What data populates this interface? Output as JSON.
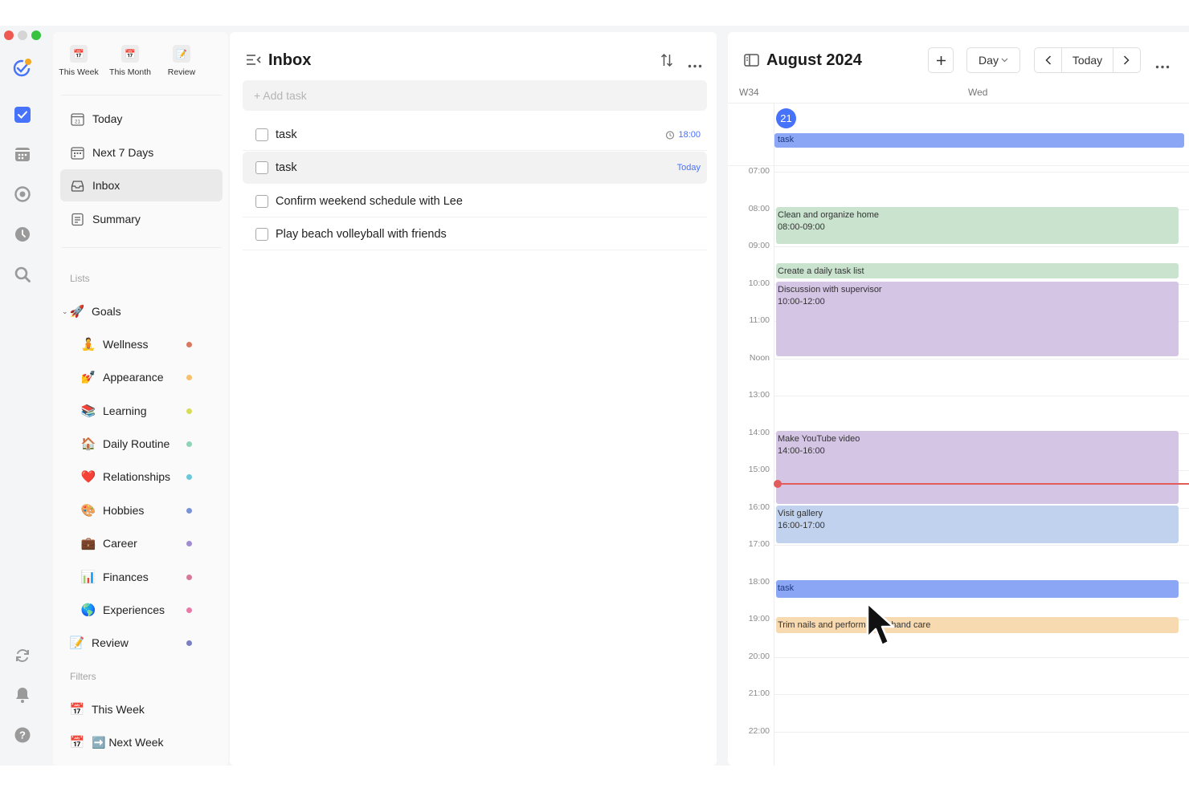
{
  "colors": {
    "accent": "#4772fa",
    "now_line": "#e25c5c",
    "event_green": "#c9e3cf",
    "event_purple": "#d4c5e5",
    "event_blue": "#c0d2ee",
    "event_task": "#8aa6f5",
    "event_orange": "#f8dab1"
  },
  "rail": {
    "icons": [
      "app-logo-icon",
      "tasks-icon",
      "calendar-icon",
      "habit-icon",
      "focus-icon",
      "search-icon",
      "sync-icon",
      "notification-icon",
      "help-icon"
    ]
  },
  "sidebar": {
    "quick": [
      {
        "label": "This Week",
        "icon": "calendar-icon"
      },
      {
        "label": "This Month",
        "icon": "calendar-icon"
      },
      {
        "label": "Review",
        "icon": "memo-icon"
      }
    ],
    "nav": [
      {
        "label": "Today",
        "icon": "today-icon"
      },
      {
        "label": "Next 7 Days",
        "icon": "next-7-days-icon"
      },
      {
        "label": "Inbox",
        "icon": "inbox-icon"
      },
      {
        "label": "Summary",
        "icon": "summary-icon"
      }
    ],
    "lists_label": "Lists",
    "goals": {
      "label": "Goals",
      "emoji": "🚀"
    },
    "goal_items": [
      {
        "label": "Wellness",
        "emoji": "🧘",
        "color": "#d9775f"
      },
      {
        "label": "Appearance",
        "emoji": "💅",
        "color": "#f5c16c"
      },
      {
        "label": "Learning",
        "emoji": "📚",
        "color": "#d7dc5a"
      },
      {
        "label": "Daily Routine",
        "emoji": "🏠",
        "color": "#8fd3b8"
      },
      {
        "label": "Relationships",
        "emoji": "❤️",
        "color": "#6ac8d9"
      },
      {
        "label": "Hobbies",
        "emoji": "🎨",
        "color": "#7a93d6"
      },
      {
        "label": "Career",
        "emoji": "💼",
        "color": "#a08cd3"
      },
      {
        "label": "Finances",
        "emoji": "📊",
        "color": "#d77896"
      },
      {
        "label": "Experiences",
        "emoji": "🌎",
        "color": "#e879a8"
      }
    ],
    "review": {
      "label": "Review",
      "emoji": "📝",
      "color": "#7a7fc0"
    },
    "filters_label": "Filters",
    "filters": [
      {
        "label": "This Week",
        "emoji": "📅"
      },
      {
        "label": "➡️ Next Week",
        "emoji": "📅"
      }
    ]
  },
  "inbox": {
    "title": "Inbox",
    "add_placeholder": "+ Add task",
    "tasks": [
      {
        "title": "task",
        "meta": "18:00",
        "has_alarm": true
      },
      {
        "title": "task",
        "meta": "Today",
        "has_alarm": false
      },
      {
        "title": "Confirm weekend schedule with Lee",
        "meta": "",
        "has_alarm": false
      },
      {
        "title": "Play beach volleyball with friends",
        "meta": "",
        "has_alarm": false
      }
    ]
  },
  "calendar": {
    "title": "August 2024",
    "view": "Day",
    "today_label": "Today",
    "week": "W34",
    "weekday": "Wed",
    "date": "21",
    "all_day_event": "task",
    "hours": [
      "07:00",
      "08:00",
      "09:00",
      "10:00",
      "11:00",
      "Noon",
      "13:00",
      "14:00",
      "15:00",
      "16:00",
      "17:00",
      "18:00",
      "19:00",
      "20:00",
      "21:00",
      "22:00"
    ],
    "events": [
      {
        "title": "Clean and organize home",
        "time": "08:00-09:00",
        "color": "#c9e3cf"
      },
      {
        "title": "Create a daily task list",
        "time": "",
        "color": "#c9e3cf"
      },
      {
        "title": "Discussion with supervisor",
        "time": "10:00-12:00",
        "color": "#d4c5e5"
      },
      {
        "title": "Make YouTube video",
        "time": "14:00-16:00",
        "color": "#d4c5e5"
      },
      {
        "title": "Visit gallery",
        "time": "16:00-17:00",
        "color": "#c0d2ee"
      },
      {
        "title": "task",
        "time": "",
        "color": "#8aa6f5"
      },
      {
        "title": "Trim nails and perform basic hand care",
        "time": "",
        "color": "#f8dab1"
      }
    ]
  }
}
